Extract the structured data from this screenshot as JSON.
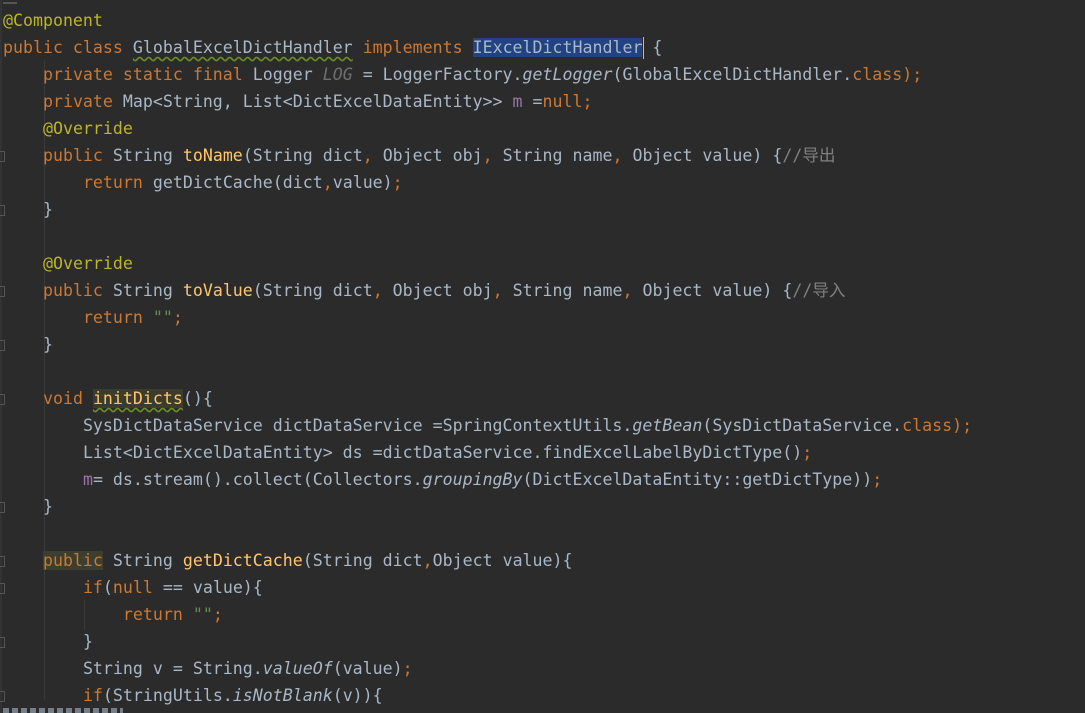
{
  "editor": {
    "language": "Java",
    "theme_colors": {
      "background": "#2b2b2b",
      "keyword": "#cc7832",
      "annotation": "#bbb529",
      "method_decl": "#ffc66d",
      "field": "#9876aa",
      "string": "#6a8759",
      "comment": "#808080",
      "default_text": "#a9b7c6",
      "selection": "#214283"
    },
    "lines": {
      "l1_ann": "@Component",
      "l2_kw1": "public class",
      "l2_cls": "GlobalExcelDictHandler",
      "l2_kw2": "implements",
      "l2_iface": "IExcelDictHandler",
      "l2_rest": " {",
      "l3_kw": "private static final",
      "l3_type": " Logger ",
      "l3_field": "LOG",
      "l3_eq": " = LoggerFactory.",
      "l3_call": "getLogger",
      "l3_args": "(GlobalExcelDictHandler.",
      "l3_cls": "class",
      "l3_end": ");",
      "l4_kw": "private",
      "l4_type": " Map<String, List<DictExcelDataEntity>> ",
      "l4_field": "m",
      "l4_eq": " =",
      "l4_null": "null",
      "l4_end": ";",
      "l5_ann": "@Override",
      "l6_kw": "public",
      "l6_type": " String ",
      "l6_fn": "toName",
      "l6_params_a": "(String dict",
      "l6_params_b": " Object obj",
      "l6_params_c": " String name",
      "l6_params_d": " Object value) {",
      "l6_cmt": "//导出",
      "l7_kw": "return",
      "l7_rest": " getDictCache(dict",
      "l7_rest2": "value)",
      "l7_end": ";",
      "l8": "}",
      "l10_ann": "@Override",
      "l11_kw": "public",
      "l11_type": " String ",
      "l11_fn": "toValue",
      "l11_params_a": "(String dict",
      "l11_params_b": " Object obj",
      "l11_params_c": " String name",
      "l11_params_d": " Object value) {",
      "l11_cmt": "//导入",
      "l12_kw": "return",
      "l12_str": "\"\"",
      "l12_end": ";",
      "l13": "}",
      "l15_kw": "void",
      "l15_fn": "initDicts",
      "l15_rest": "(){",
      "l16_a": "SysDictDataService dictDataService =SpringContextUtils.",
      "l16_call": "getBean",
      "l16_b": "(SysDictDataService.",
      "l16_cls": "class",
      "l16_end": ");",
      "l17_a": "List<DictExcelDataEntity> ds =dictDataService.findExcelLabelByDictType()",
      "l17_end": ";",
      "l18_field": "m",
      "l18_a": "= ds.stream().collect(Collectors.",
      "l18_call": "groupingBy",
      "l18_b": "(DictExcelDataEntity::getDictType))",
      "l18_end": ";",
      "l19": "}",
      "l21_kw": "public",
      "l21_type": " String ",
      "l21_fn": "getDictCache",
      "l21_params_a": "(String dict",
      "l21_params_b": "Object value){",
      "l22_kw": "if",
      "l22_a": "(",
      "l22_null": "null",
      "l22_b": " == value){",
      "l23_kw": "return",
      "l23_str": "\"\"",
      "l23_end": ";",
      "l24": "}",
      "l25_a": "String v = String.",
      "l25_call": "valueOf",
      "l25_b": "(value)",
      "l25_end": ";",
      "l26_kw": "if",
      "l26_a": "(StringUtils.",
      "l26_call": "isNotBlank",
      "l26_b": "(v)){"
    }
  }
}
